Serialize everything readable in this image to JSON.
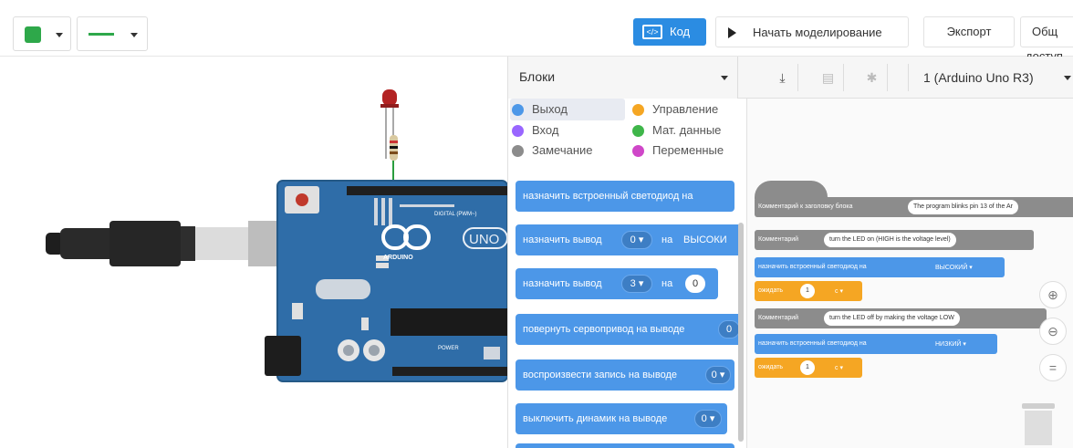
{
  "toolbar": {
    "color_value": "#2ea84a",
    "code_button_label": "Код",
    "simulate_button_label": "Начать моделирование",
    "export_button_label": "Экспорт",
    "share_button_label": "Общ",
    "share_button_label_cont": "доступ"
  },
  "code_panel": {
    "category_select": "Блоки",
    "device_select": "1 (Arduino Uno R3)",
    "categories": [
      {
        "label": "Выход",
        "color": "#4c97e8"
      },
      {
        "label": "Управление",
        "color": "#f5a623"
      },
      {
        "label": "Вход",
        "color": "#9966ff"
      },
      {
        "label": "Мат. данные",
        "color": "#3fb64a"
      },
      {
        "label": "Замечание",
        "color": "#8c8c8c"
      },
      {
        "label": "Переменные",
        "color": "#cf47c8"
      }
    ],
    "palette": [
      {
        "label": "назначить встроенный светодиод на"
      },
      {
        "label": "назначить вывод",
        "pin": "0 ▾",
        "on": "на",
        "value": "ВЫСОКИ"
      },
      {
        "label": "назначить вывод",
        "pin": "3 ▾",
        "on": "на",
        "value": "0"
      },
      {
        "label": "повернуть сервопривод на выводе",
        "pin": "0"
      },
      {
        "label": "воспроизвести запись на выводе",
        "pin": "0 ▾"
      },
      {
        "label": "выключить динамик на выводе",
        "pin": "0 ▾"
      }
    ]
  },
  "script": {
    "c1_label": "Комментарий к заголовку блока",
    "c1_text": "The program blinks pin 13 of the Ar",
    "c2_label": "Комментарий",
    "c2_text": "turn the LED on (HIGH is the voltage level)",
    "s1_label": "назначить встроенный светодиод на",
    "s1_value": "ВЫСОКИЙ ▾",
    "w1_label": "ожидать",
    "w1_value": "1",
    "w1_unit": "с ▾",
    "c3_label": "Комментарий",
    "c3_text": "turn the LED off by making the voltage LOW",
    "s2_label": "назначить встроенный светодиод на",
    "s2_value": "НИЗКИЙ ▾",
    "w2_label": "ожидать",
    "w2_value": "1",
    "w2_unit": "с ▾"
  },
  "board": {
    "brand": "ARDUINO",
    "model": "UNO",
    "digital_label": "DIGITAL (PWM~)",
    "power_label": "POWER"
  }
}
